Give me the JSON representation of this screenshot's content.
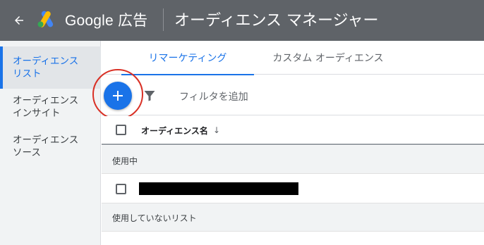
{
  "header": {
    "brand_google": "Google",
    "brand_ads": "広告",
    "title": "オーディエンス マネージャー",
    "icons": {
      "back": "arrow-back-icon",
      "logo": "google-ads-logo"
    }
  },
  "sidebar": {
    "items": [
      {
        "line1": "オーディエンス",
        "line2": "リスト",
        "active": true
      },
      {
        "line1": "オーディエンス",
        "line2": "インサイト",
        "active": false
      },
      {
        "line1": "オーディエンス",
        "line2": "ソース",
        "active": false
      }
    ]
  },
  "tabs": [
    {
      "label": "リマーケティング",
      "active": true
    },
    {
      "label": "カスタム オーディエンス",
      "active": false
    }
  ],
  "toolbar": {
    "add_icon": "plus-icon",
    "filter_icon": "filter-icon",
    "filter_label": "フィルタを追加"
  },
  "table": {
    "column_header": "オーディエンス名",
    "sort_icon": "arrow-down-icon",
    "groups": [
      {
        "label": "使用中",
        "rows": [
          {
            "name_redacted": true
          }
        ]
      },
      {
        "label": "使用していないリスト",
        "rows": []
      }
    ]
  },
  "colors": {
    "header_bg": "#5f6368",
    "accent": "#1a73e8",
    "highlight_ring": "#d93025",
    "sidebar_bg": "#f1f3f4"
  }
}
